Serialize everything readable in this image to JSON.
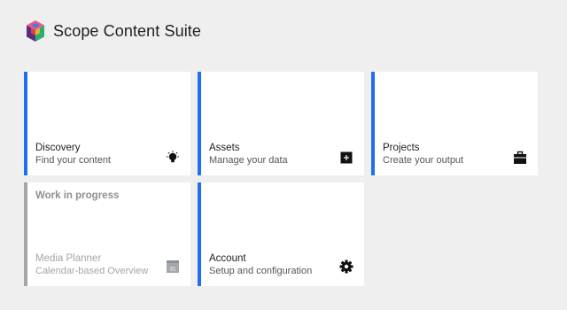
{
  "app": {
    "title": "Scope Content Suite",
    "logo_icon": "cube-logo-icon"
  },
  "colors": {
    "accent": "#1f6ff1",
    "disabled": "#a3a6ab",
    "background": "#efefef"
  },
  "tiles": [
    {
      "title": "Discovery",
      "subtitle": "Find your content",
      "icon": "lightbulb-icon"
    },
    {
      "title": "Assets",
      "subtitle": "Manage your data",
      "icon": "plus-square-icon"
    },
    {
      "title": "Projects",
      "subtitle": "Create your output",
      "icon": "briefcase-icon"
    },
    {
      "badge": "Work in progress",
      "title": "Media Planner",
      "subtitle": "Calendar-based Overview",
      "icon": "calendar-icon",
      "calendar_day": "31"
    },
    {
      "title": "Account",
      "subtitle": "Setup and configuration",
      "icon": "gear-icon"
    }
  ]
}
